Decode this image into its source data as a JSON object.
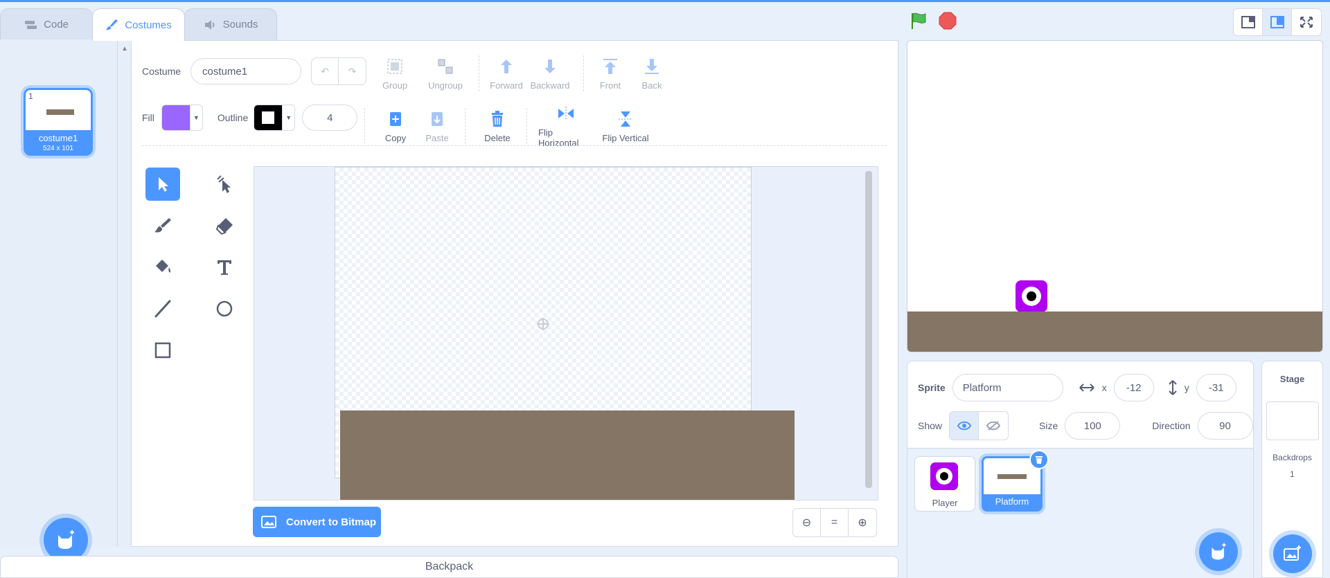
{
  "tabs": [
    {
      "label": "Code",
      "icon": "code-icon"
    },
    {
      "label": "Costumes",
      "icon": "brush-icon"
    },
    {
      "label": "Sounds",
      "icon": "speaker-icon"
    }
  ],
  "costumes": [
    {
      "number": "1",
      "name": "costume1",
      "size": "524 x 101"
    }
  ],
  "editor": {
    "costume_label": "Costume",
    "costume_name": "costume1",
    "group": "Group",
    "ungroup": "Ungroup",
    "forward": "Forward",
    "backward": "Backward",
    "front": "Front",
    "back": "Back",
    "fill_label": "Fill",
    "fill_color": "#9966ff",
    "outline_label": "Outline",
    "outline_color": "#000000",
    "outline_width": "4",
    "copy": "Copy",
    "paste": "Paste",
    "delete": "Delete",
    "flip_h": "Flip Horizontal",
    "flip_v": "Flip Vertical",
    "convert": "Convert to Bitmap",
    "zoom_reset": "="
  },
  "backpack": "Backpack",
  "sprite": {
    "label": "Sprite",
    "name": "Platform",
    "x_label": "x",
    "x": "-12",
    "y_label": "y",
    "y": "-31",
    "show_label": "Show",
    "size_label": "Size",
    "size": "100",
    "direction_label": "Direction",
    "direction": "90"
  },
  "sprites": [
    {
      "name": "Player"
    },
    {
      "name": "Platform"
    }
  ],
  "stage_pane": {
    "title": "Stage",
    "backdrops_label": "Backdrops",
    "backdrops_count": "1"
  },
  "colors": {
    "accent": "#4c97ff",
    "ground": "#857565",
    "player": "#b000f0"
  }
}
